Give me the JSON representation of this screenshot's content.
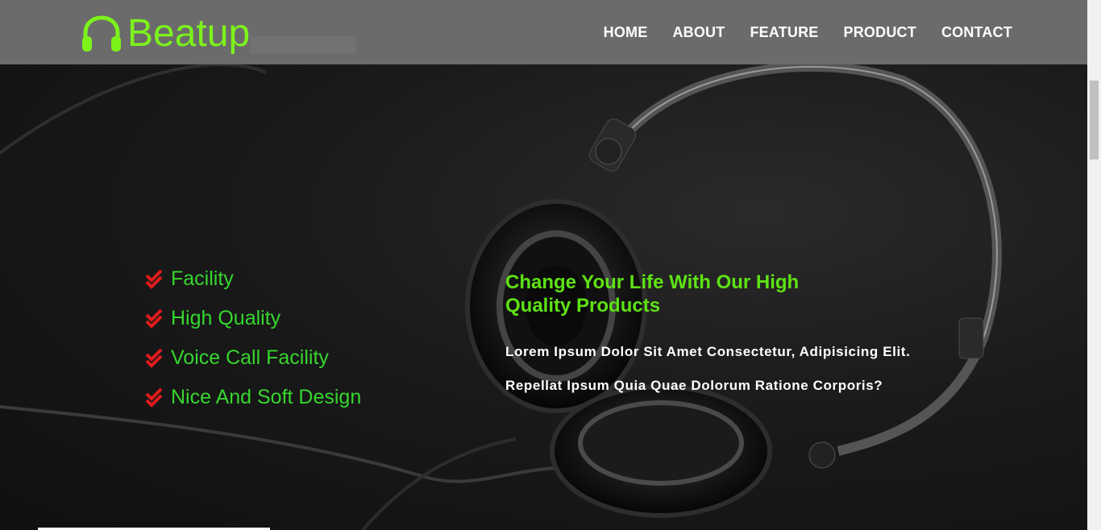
{
  "brand": {
    "name": "Beatup",
    "icon": "headphones-icon",
    "color": "#7cf21b"
  },
  "nav": {
    "items": [
      {
        "label": "HOME"
      },
      {
        "label": "ABOUT"
      },
      {
        "label": "FEATURE"
      },
      {
        "label": "PRODUCT"
      },
      {
        "label": "CONTACT"
      }
    ]
  },
  "features": {
    "icon": "double-check-icon",
    "icon_color": "#e11b1b",
    "text_color": "#36d62e",
    "items": [
      {
        "label": "Facility"
      },
      {
        "label": "High Quality"
      },
      {
        "label": "Voice Call Facility"
      },
      {
        "label": "Nice And Soft Design"
      }
    ]
  },
  "promo": {
    "title": "Change Your Life With Our High Quality Products",
    "line1": "Lorem Ipsum Dolor Sit Amet Consectetur, Adipisicing Elit.",
    "line2": "Repellat Ipsum Quia Quae Dolorum Ratione Corporis?"
  },
  "colors": {
    "navbar": "#6b6b6b",
    "accent": "#5ee214",
    "background": "#161616"
  }
}
